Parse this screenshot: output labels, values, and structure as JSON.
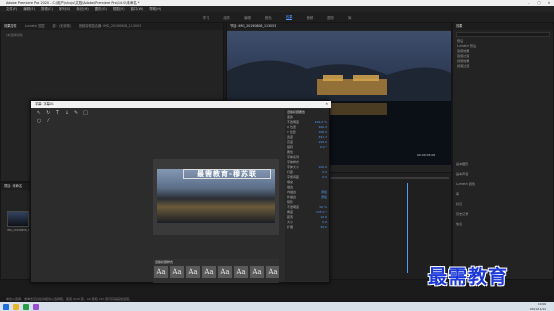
{
  "window": {
    "title": "Adobe Premiere Pro 2020 - C:\\用户\\shuju\\文档\\Adobe\\Premiere Pro\\14.0\\未命名 *"
  },
  "menu": [
    "文件(F)",
    "编辑(E)",
    "剪辑(C)",
    "序列(S)",
    "标记(M)",
    "图形(G)",
    "视图(V)",
    "窗口(W)",
    "帮助(H)"
  ],
  "workspaces": [
    "学习",
    "组件",
    "编辑",
    "颜色",
    "效果",
    "音频",
    "图形",
    "库"
  ],
  "active_workspace": "效果",
  "effects_panel": {
    "tabs": [
      "效果控件",
      "Lumetri 范围",
      "源：(无剪辑)",
      "音频剪辑混合器: IMG_20190808_113053"
    ],
    "message": "(未选择剪辑)"
  },
  "program_monitor": {
    "tab": "节目: IMG_20190808_113053",
    "zoom": "适合",
    "timecode": "00:00:00:00",
    "duration": "00:00:05:00"
  },
  "project_panel": {
    "tab": "项目: 未命名",
    "items": [
      "IMG_20190808_113053"
    ]
  },
  "right_panel": {
    "tab": "效果",
    "folders": [
      "预设",
      "Lumetri 预设",
      "音频效果",
      "音频过渡",
      "视频效果",
      "视频过渡"
    ],
    "bottom": [
      "基本图形",
      "基本声音",
      "Lumetri 颜色",
      "库",
      "标记",
      "历史记录",
      "信息"
    ]
  },
  "title_dialog": {
    "title": "字幕: 字幕01",
    "caption_text": "最需教育-穆苏联",
    "properties_header": "旧版标题属性",
    "properties": [
      {
        "label": "变换",
        "value": ""
      },
      {
        "label": "不透明度",
        "value": "100.0 %"
      },
      {
        "label": "X 位置",
        "value": "306.3"
      },
      {
        "label": "Y 位置",
        "value": "106.2"
      },
      {
        "label": "宽度",
        "value": "391.7"
      },
      {
        "label": "高度",
        "value": "100.0"
      },
      {
        "label": "旋转",
        "value": "0.0 °"
      },
      {
        "label": "属性",
        "value": ""
      },
      {
        "label": "字体系列",
        "value": ""
      },
      {
        "label": "字体样式",
        "value": ""
      },
      {
        "label": "字体大小",
        "value": "100.0"
      },
      {
        "label": "行距",
        "value": "0.0"
      },
      {
        "label": "字偶间距",
        "value": "0.0"
      },
      {
        "label": "填充",
        "value": ""
      },
      {
        "label": "描边",
        "value": ""
      },
      {
        "label": "内描边",
        "value": "添加"
      },
      {
        "label": "外描边",
        "value": "添加"
      },
      {
        "label": "阴影",
        "value": ""
      },
      {
        "label": "不透明度",
        "value": "50 %"
      },
      {
        "label": "角度",
        "value": "135.0 °"
      },
      {
        "label": "距离",
        "value": "10.0"
      },
      {
        "label": "大小",
        "value": "0.0"
      },
      {
        "label": "扩展",
        "value": "30.0"
      }
    ],
    "styles_header": "旧版标题样式",
    "styles": [
      "Aa",
      "Aa",
      "Aa",
      "Aa",
      "Aa",
      "Aa",
      "Aa",
      "Aa"
    ]
  },
  "watermark": "最需教育",
  "statusbar": "单击以选择，或单击空白处并拖动以选择框，使用 Shift 键、Alt 键和 Ctrl 键可获得其他选项。",
  "clock": {
    "time": "10:06",
    "date": "2021/11/12"
  }
}
